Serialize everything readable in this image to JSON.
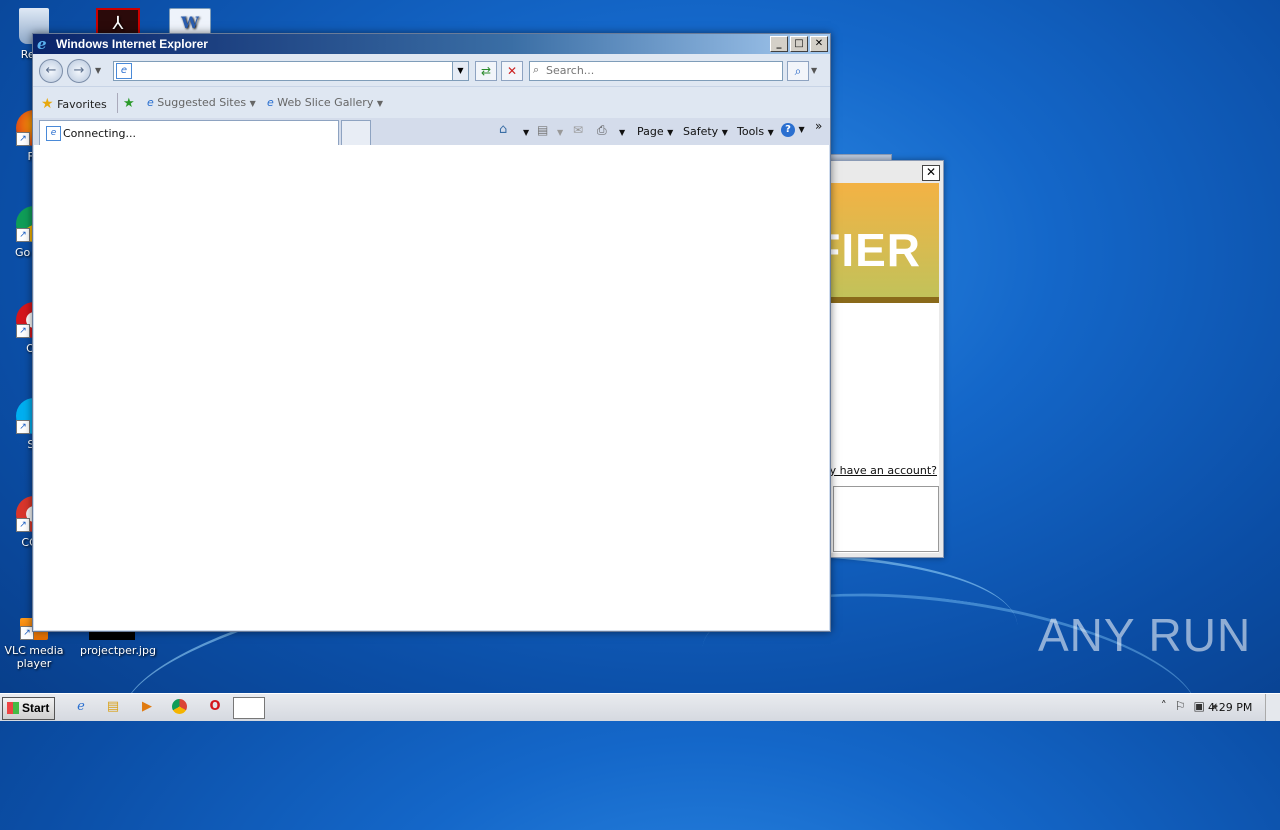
{
  "desktop": {
    "icons": [
      {
        "label": "Recy",
        "icon": "recycle-bin-icon"
      },
      {
        "label": "Fir",
        "icon": "firefox-icon"
      },
      {
        "label": "Go Chr",
        "icon": "chrome-icon"
      },
      {
        "label": "Op",
        "icon": "opera-icon"
      },
      {
        "label": "Sk",
        "icon": "skype-icon"
      },
      {
        "label": "CCle",
        "icon": "ccleaner-icon"
      },
      {
        "label": "VLC media player",
        "icon": "vlc-icon"
      },
      {
        "label": "projectper.jpg",
        "icon": "image-file-icon"
      }
    ],
    "watermark": "ANY RUN"
  },
  "background_window": {
    "banner_text": "FIER",
    "link_text": "ady have an account?",
    "close_label": "✕"
  },
  "ie": {
    "title": "Windows Internet Explorer",
    "address_value": "",
    "search_placeholder": "Search...",
    "favorites": {
      "favorites_label": "Favorites",
      "suggested_sites": "Suggested Sites",
      "web_slice_gallery": "Web Slice Gallery"
    },
    "tab": {
      "label": "Connecting..."
    },
    "commands": {
      "page": "Page",
      "safety": "Safety",
      "tools": "Tools"
    }
  },
  "taskbar": {
    "start_label": "Start",
    "clock": "4:29 PM"
  },
  "colors": {
    "desktop_bg": "#1467c9",
    "titlebar": "#0a246a",
    "banner": "#f3b244"
  }
}
